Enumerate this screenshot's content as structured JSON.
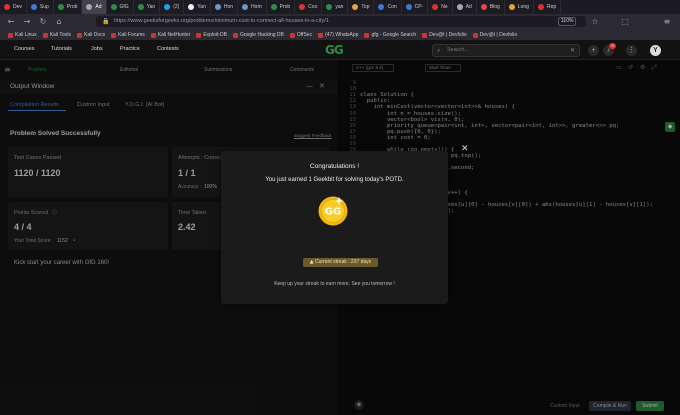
{
  "browser": {
    "tabs": [
      {
        "label": "Dev",
        "color": "#d33"
      },
      {
        "label": "Sup",
        "color": "#3a7bd5"
      },
      {
        "label": "Prob",
        "color": "#2f8d46"
      },
      {
        "label": "Ad",
        "color": "#aaa"
      },
      {
        "label": "GfG",
        "color": "#2f8d46"
      },
      {
        "label": "Yan",
        "color": "#2f8d46"
      },
      {
        "label": "(2)",
        "color": "#1da1f2"
      },
      {
        "label": "Yan",
        "color": "#eee"
      },
      {
        "label": "Hon",
        "color": "#6699cc"
      },
      {
        "label": "Hom",
        "color": "#6699cc"
      },
      {
        "label": "Prob",
        "color": "#2f8d46"
      },
      {
        "label": "Coo",
        "color": "#d33"
      },
      {
        "label": "yan",
        "color": "#2f8d46"
      },
      {
        "label": "Top",
        "color": "#e8a33a"
      },
      {
        "label": "Con",
        "color": "#3a7bd5"
      },
      {
        "label": "CP-",
        "color": "#3a7bd5"
      },
      {
        "label": "Ne",
        "color": "#d33"
      },
      {
        "label": "Ad",
        "color": "#aaa"
      },
      {
        "label": "Blog",
        "color": "#e44"
      },
      {
        "label": "Long",
        "color": "#e8a33a"
      },
      {
        "label": "Rep",
        "color": "#d33"
      }
    ],
    "active_tab_index": 3,
    "url": "https://www.geeksforgeeks.org/problems/minimum-cost-to-connect-all-houses-in-a-city/1",
    "zoom": "110%",
    "bookmarks": [
      "Kali Linux",
      "Kali Tools",
      "Kali Docs",
      "Kali Forums",
      "Kali NetHunter",
      "Exploit-DB",
      "Google Hacking DB",
      "OffSec",
      "(47) WhatsApp",
      "gfg - Google Search",
      "Dev@t | Devfolio",
      "Dev@t | Devfolio"
    ]
  },
  "site": {
    "logo": "GG",
    "nav": [
      "Courses",
      "Tutorials",
      "Jobs",
      "Practice",
      "Contests"
    ],
    "search_placeholder": "Search...",
    "notif_count": "9",
    "avatar": "Y"
  },
  "left": {
    "panel_tabs": [
      "Problem",
      "Editorial",
      "Submissions",
      "Comments"
    ],
    "output_window_title": "Output Window",
    "sub_tabs": [
      "Compilation Results",
      "Custom Input",
      "Y.O.G.I. (AI Bot)"
    ],
    "status": "Problem Solved Successfully",
    "suggest_feedback": "Suggest Feedback",
    "test_cases_label": "Test Cases Passed",
    "test_cases_value": "1120 / 1120",
    "attempts_label": "Attempts : Correct",
    "attempts_value": "1 / 1",
    "accuracy_label": "Accuracy :",
    "accuracy_value": "100%",
    "points_label": "Points Scored",
    "points_value": "4 / 4",
    "total_score_label": "Your Total Score:",
    "total_score_value": "1152",
    "time_label": "Time Taken",
    "time_value": "2.42",
    "career_text": "Kick start your career with GfG 160!"
  },
  "editor": {
    "lang": "C++ (gcc 5.4)",
    "start_timer": "Start Timer",
    "lines": [
      {
        "n": "9",
        "t": ""
      },
      {
        "n": "10",
        "t": ""
      },
      {
        "n": "11",
        "t": "class Solution {"
      },
      {
        "n": "12",
        "t": "  public:"
      },
      {
        "n": "13",
        "t": "    int minCost(vector<vector<int>>& houses) {"
      },
      {
        "n": "14",
        "t": "        int n = houses.size();"
      },
      {
        "n": "15",
        "t": "        vector<bool> vis(n, 0);"
      },
      {
        "n": "16",
        "t": "        priority_queue<pair<int, int>, vector<pair<int, int>>, greater<>> pq;"
      },
      {
        "n": "17",
        "t": "        pq.push({0, 0});"
      },
      {
        "n": "18",
        "t": "        int cost = 0;"
      },
      {
        "n": "19",
        "t": ""
      },
      {
        "n": "20",
        "t": "        while (pq.empty()) {"
      },
      {
        "n": "21",
        "t": "                           pq.top();"
      },
      {
        "n": "22",
        "t": ""
      },
      {
        "n": "23",
        "t": "                       = p.second;"
      },
      {
        "n": "24",
        "t": "                        e;"
      },
      {
        "n": "25",
        "t": ""
      },
      {
        "n": "26",
        "t": ""
      },
      {
        "n": "27",
        "t": "                        ; v++) {"
      },
      {
        "n": "28",
        "t": ""
      },
      {
        "n": "29",
        "t": "                   abs(houses[u][0] - houses[v][0]) + abs(houses[u][1] - houses[v][1]);"
      },
      {
        "n": "30",
        "t": "                        v});"
      }
    ],
    "custom_input": "Custom Input",
    "compile_run": "Compile & Run",
    "submit": "Submit"
  },
  "modal": {
    "title": "Congratulations !",
    "message": "You just earned 1 Geekbit for solving today's POTD.",
    "streak": "Current streak : 237 days",
    "footer": "Keep up your streak to earn more. See you tomorrow !"
  },
  "colors": {
    "brand": "#2f8d46",
    "coin": "#f5c518",
    "streak_bg": "#6b5a2c"
  }
}
